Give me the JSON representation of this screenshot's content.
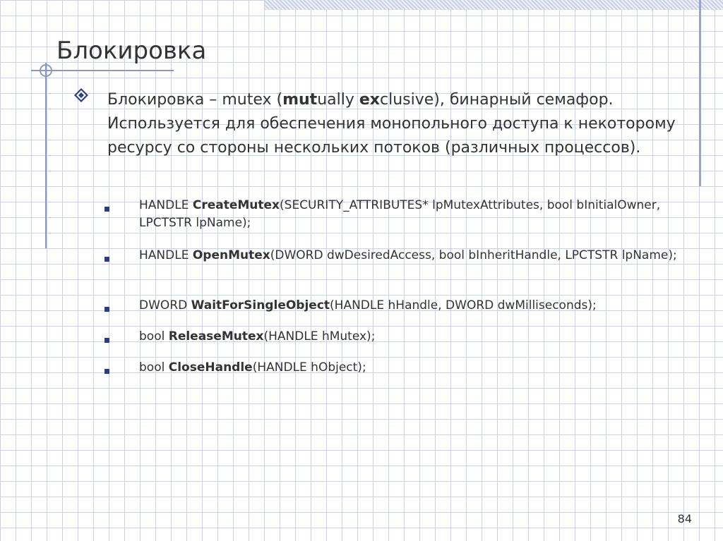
{
  "slide": {
    "title": "Блокировка",
    "main": {
      "segments": [
        {
          "text": "Блокировка – mutex (",
          "bold": false
        },
        {
          "text": "mut",
          "bold": true
        },
        {
          "text": "ually ",
          "bold": false
        },
        {
          "text": "ex",
          "bold": true
        },
        {
          "text": "clusive), бинарный семафор. Используется для обеспечения монопольного доступа к некоторому ресурсу со стороны нескольких потоков (различных процессов).",
          "bold": false
        }
      ]
    },
    "items": [
      {
        "pre": "HANDLE ",
        "name": "CreateMutex",
        "post": "(SECURITY_ATTRIBUTES* lpMutexAttributes, bool bInitialOwner, LPCTSTR lpName);"
      },
      {
        "pre": "HANDLE ",
        "name": "OpenMutex",
        "post": "(DWORD dwDesiredAccess, bool bInheritHandle, LPCTSTR lpName);"
      },
      {
        "pre": "DWORD ",
        "name": "WaitForSingleObject",
        "post": "(HANDLE hHandle, DWORD dwMilliseconds);"
      },
      {
        "pre": "bool ",
        "name": "ReleaseMutex",
        "post": "(HANDLE hMutex);"
      },
      {
        "pre": "bool ",
        "name": "CloseHandle",
        "post": "(HANDLE hObject);"
      }
    ],
    "page_number": "84",
    "colors": {
      "accent_line": "#8c96c0",
      "bullet": "#2a3a8c",
      "text": "#333333"
    }
  }
}
